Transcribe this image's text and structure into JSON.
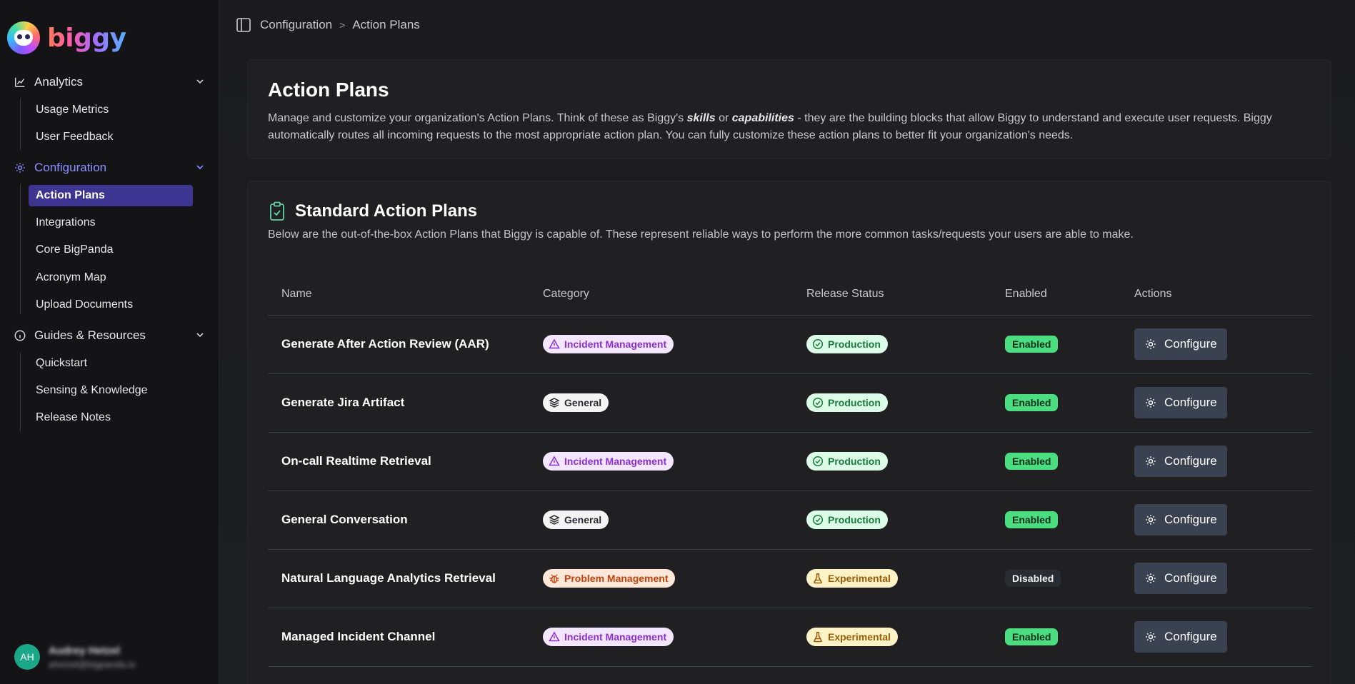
{
  "app": {
    "logo_text": "biggy"
  },
  "sidebar": {
    "sections": [
      {
        "label": "Analytics",
        "icon": "chart-icon",
        "items": [
          "Usage Metrics",
          "User Feedback"
        ]
      },
      {
        "label": "Configuration",
        "icon": "gear-icon",
        "items": [
          "Action Plans",
          "Integrations",
          "Core BigPanda",
          "Acronym Map",
          "Upload Documents"
        ]
      },
      {
        "label": "Guides & Resources",
        "icon": "info-icon",
        "items": [
          "Quickstart",
          "Sensing & Knowledge",
          "Release Notes"
        ]
      }
    ],
    "selected_item": "Action Plans",
    "active_section": "Configuration",
    "user": {
      "initials": "AH",
      "name": "Audrey Hetzel",
      "email": "aheizel@bigpanda.io"
    }
  },
  "breadcrumb": {
    "parent": "Configuration",
    "separator": ">",
    "current": "Action Plans"
  },
  "intro": {
    "title": "Action Plans",
    "desc_part1": "Manage and customize your organization's Action Plans. Think of these as Biggy's ",
    "desc_skills": "skills",
    "desc_or": " or ",
    "desc_capabilities": "capabilities",
    "desc_part2": " - they are the building blocks that allow Biggy to understand and execute user requests. Biggy automatically routes all incoming requests to the most appropriate action plan. You can fully customize these action plans to better fit your organization's needs."
  },
  "standard": {
    "title": "Standard Action Plans",
    "description": "Below are the out-of-the-box Action Plans that Biggy is capable of. These represent reliable ways to perform the more common tasks/requests your users are able to make.",
    "columns": [
      "Name",
      "Category",
      "Release Status",
      "Enabled",
      "Actions"
    ],
    "rows": [
      {
        "name": "Generate After Action Review (AAR)",
        "category": "Incident Management",
        "category_type": "incident",
        "release": "Production",
        "release_type": "production",
        "enabled": "Enabled",
        "enabled_type": "enabled",
        "action": "Configure"
      },
      {
        "name": "Generate Jira Artifact",
        "category": "General",
        "category_type": "general",
        "release": "Production",
        "release_type": "production",
        "enabled": "Enabled",
        "enabled_type": "enabled",
        "action": "Configure"
      },
      {
        "name": "On-call Realtime Retrieval",
        "category": "Incident Management",
        "category_type": "incident",
        "release": "Production",
        "release_type": "production",
        "enabled": "Enabled",
        "enabled_type": "enabled",
        "action": "Configure"
      },
      {
        "name": "General Conversation",
        "category": "General",
        "category_type": "general",
        "release": "Production",
        "release_type": "production",
        "enabled": "Enabled",
        "enabled_type": "enabled",
        "action": "Configure"
      },
      {
        "name": "Natural Language Analytics Retrieval",
        "category": "Problem Management",
        "category_type": "problem",
        "release": "Experimental",
        "release_type": "experimental",
        "enabled": "Disabled",
        "enabled_type": "disabled",
        "action": "Configure"
      },
      {
        "name": "Managed Incident Channel",
        "category": "Incident Management",
        "category_type": "incident",
        "release": "Experimental",
        "release_type": "experimental",
        "enabled": "Enabled",
        "enabled_type": "enabled",
        "action": "Configure"
      }
    ]
  },
  "colors": {
    "accent": "#8b90ff",
    "selected_bg": "#3d3591",
    "enabled_green": "#4ade80",
    "button_bg": "#3a4150"
  }
}
